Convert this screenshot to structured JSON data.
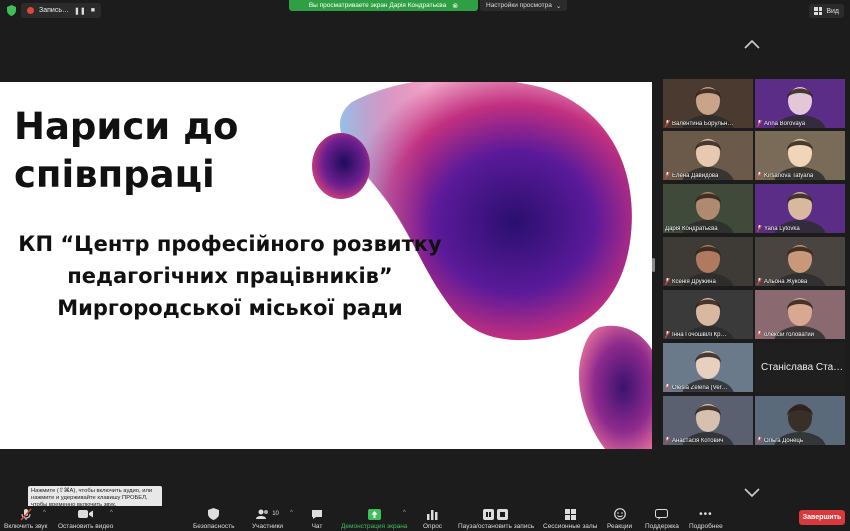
{
  "topbar": {
    "recording_label": "Запись…",
    "sharing_banner": "Вы просматриваете экран Дарія Кондратьєва",
    "view_options": "Настройки просмотра",
    "view_button": "Вид"
  },
  "slide": {
    "title_line1": "Нариси до",
    "title_line2": "співпраці",
    "sub_line1": "КП “Центр професійного розвитку",
    "sub_line2": "педагогічних працівників”",
    "sub_line3": "Миргородської міської ради"
  },
  "participants": [
    {
      "name": "Валентина Борульн…",
      "muted": true
    },
    {
      "name": "Anna Borovaya",
      "muted": true
    },
    {
      "name": "Елена Давидова",
      "muted": true
    },
    {
      "name": "Kirsanova Tatyana",
      "muted": true
    },
    {
      "name": "Дарія Кондратьєва",
      "muted": false
    },
    {
      "name": "Yana Lytovka",
      "muted": true
    },
    {
      "name": "Ксенія Дружина",
      "muted": true
    },
    {
      "name": "Альона Жукова",
      "muted": true
    },
    {
      "name": "Інна Гочошвілі Кр…",
      "muted": true
    },
    {
      "name": "олексій головатий",
      "muted": true
    },
    {
      "name": "Olesia Zelena (Ver…",
      "muted": true
    },
    {
      "name": "Станіслава Ста…",
      "muted": false
    },
    {
      "name": "Анастасія Котович",
      "muted": true
    },
    {
      "name": "Ольга Донець",
      "muted": true
    }
  ],
  "tooltip": {
    "line1": "Нажмите  (⇧⌘A), чтобы включить аудио, или",
    "line2": "нажмите и удерживайте клавишу ПРОБЕЛ,",
    "line3": "чтобы временно включить звук."
  },
  "toolbar": {
    "unmute": "Включить звук",
    "stop_video": "Остановить видео",
    "security": "Безопасность",
    "participants": "Участники",
    "participants_count": "10",
    "chat": "Чат",
    "share_screen": "Демонстрация экрана",
    "polls": "Опрос",
    "record": "Пауза/остановить запись",
    "breakout": "Сессионные залы",
    "reactions": "Реакции",
    "support": "Поддержка",
    "more": "Подробнее",
    "end": "Завершить"
  },
  "colors": {
    "share_green": "#2ea043",
    "end_red": "#d9393a",
    "active_speaker": "#c9d93a"
  }
}
